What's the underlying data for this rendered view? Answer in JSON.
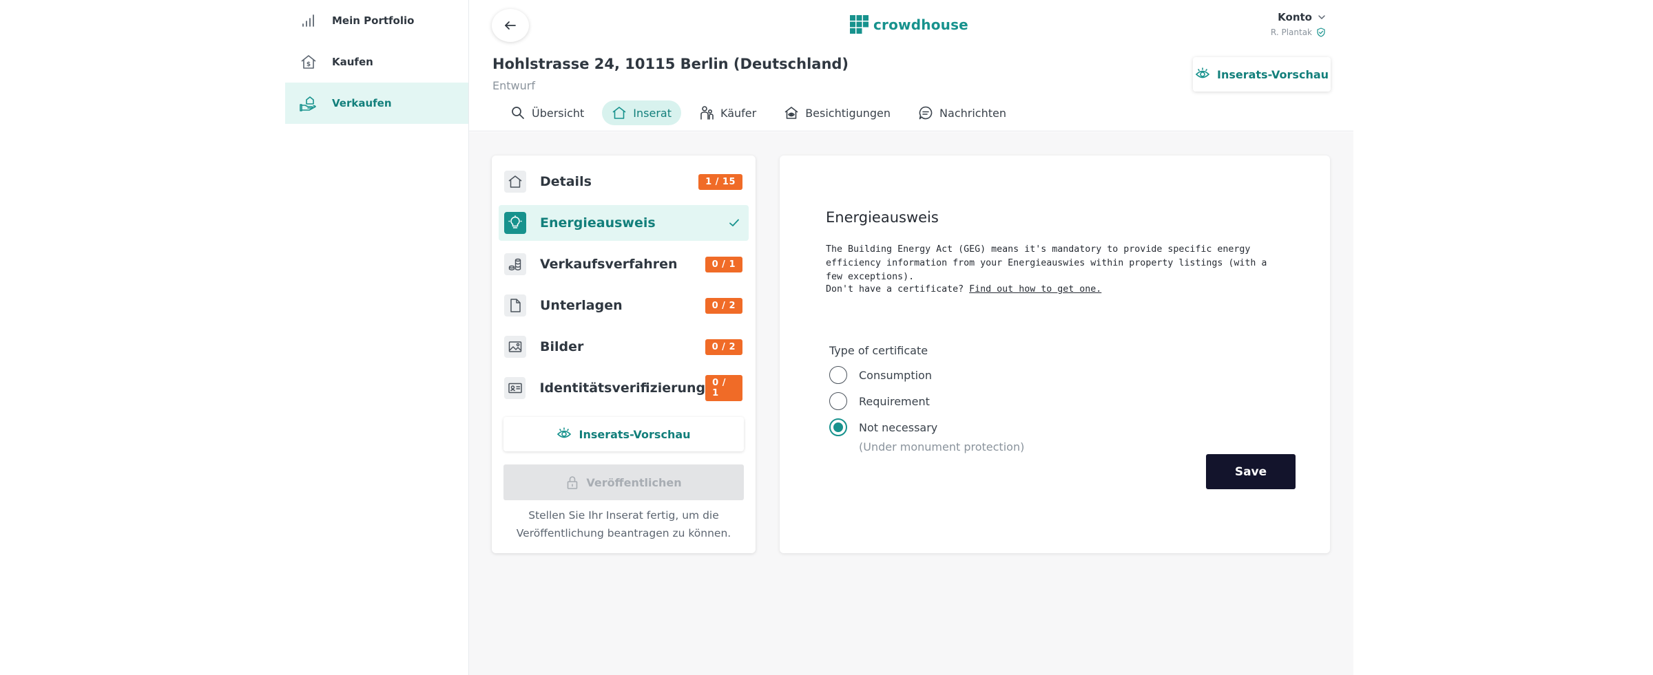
{
  "sidebar": {
    "items": [
      {
        "label": "Mein Portfolio",
        "icon": "chart-bars-icon"
      },
      {
        "label": "Kaufen",
        "icon": "house-dollar-icon"
      },
      {
        "label": "Verkaufen",
        "icon": "hand-house-icon",
        "active": true
      }
    ]
  },
  "header": {
    "brand": "crowdhouse",
    "account_label": "Konto",
    "user_name": "R. Plantak",
    "title": "Hohlstrasse 24, 10115 Berlin (Deutschland)",
    "status": "Entwurf",
    "preview_label": "Inserats-Vorschau",
    "tabs": [
      {
        "label": "Übersicht",
        "icon": "search-icon"
      },
      {
        "label": "Inserat",
        "icon": "house-icon",
        "active": true
      },
      {
        "label": "Käufer",
        "icon": "people-icon"
      },
      {
        "label": "Besichtigungen",
        "icon": "house-eye-icon"
      },
      {
        "label": "Nachrichten",
        "icon": "chat-icon"
      }
    ]
  },
  "steps": {
    "items": [
      {
        "label": "Details",
        "badge": "1 / 15",
        "icon": "house-icon"
      },
      {
        "label": "Energieausweis",
        "badge": "",
        "icon": "lightbulb-icon",
        "active": true,
        "complete": true
      },
      {
        "label": "Verkaufsverfahren",
        "badge": "0 / 1",
        "icon": "coins-icon"
      },
      {
        "label": "Unterlagen",
        "badge": "0 / 2",
        "icon": "document-icon"
      },
      {
        "label": "Bilder",
        "badge": "0 / 2",
        "icon": "image-icon"
      },
      {
        "label": "Identitätsverifizierung",
        "badge": "0 / 1",
        "icon": "id-card-icon"
      }
    ],
    "preview_label": "Inserats-Vorschau",
    "publish_label": "Veröffentlichen",
    "publish_hint_1": "Stellen Sie Ihr Inserat fertig, um die",
    "publish_hint_2": "Veröffentlichung beantragen zu können."
  },
  "form": {
    "title": "Energieausweis",
    "text_1": "The Building Energy Act (GEG) means it's mandatory to provide specific energy efficiency information from your Energieauswies within property listings (with a few exceptions).",
    "text_2_prefix": "Don't have a certificate? ",
    "text_2_link": "Find out how to get one.",
    "cert_label": "Type of certificate",
    "options": [
      {
        "label": "Consumption",
        "checked": false
      },
      {
        "label": "Requirement",
        "checked": false
      },
      {
        "label": "Not necessary",
        "checked": true
      }
    ],
    "option_note": "(Under monument protection)",
    "save_label": "Save"
  },
  "colors": {
    "accent": "#17928d",
    "accent_light": "#e3f6f3",
    "badge": "#f06b27",
    "save_bg": "#13142c"
  }
}
